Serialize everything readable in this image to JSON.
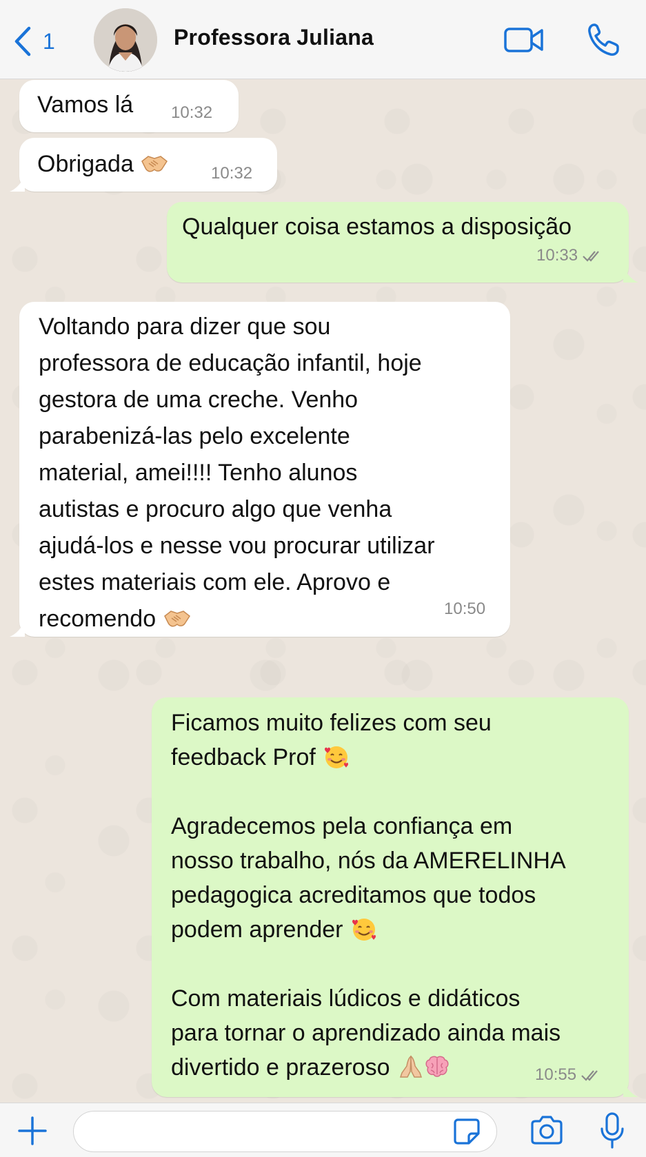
{
  "header": {
    "back_count": "1",
    "contact_name": "Professora Juliana"
  },
  "messages": [
    {
      "direction": "in",
      "text": "Vamos lá",
      "time": "10:32"
    },
    {
      "direction": "in",
      "text": "Obrigada",
      "emoji": "handshake",
      "time": "10:32"
    },
    {
      "direction": "out",
      "text": "Qualquer coisa estamos a disposição",
      "time": "10:33",
      "read": true
    },
    {
      "direction": "in",
      "lines": [
        "Voltando para dizer que sou",
        "professora de educação infantil, hoje",
        "gestora de uma creche. Venho",
        "parabenizá-las pelo excelente",
        "material, amei!!!! Tenho alunos",
        "autistas e procuro algo que venha",
        "ajudá-los e nesse vou procurar utilizar",
        "estes materiais com ele. Aprovo e",
        "recomendo"
      ],
      "emoji": "handshake",
      "time": "10:50"
    },
    {
      "direction": "out",
      "lines": [
        "Ficamos muito felizes com seu",
        "feedback Prof",
        "",
        "Agradecemos pela confiança em",
        "nosso trabalho, nós da AMERELINHA",
        "pedagogica acreditamos que todos",
        "podem aprender",
        "",
        "Com materiais lúdicos e didáticos",
        "para tornar o aprendizado ainda mais",
        "divertido e prazeroso"
      ],
      "emojis": [
        "smiling-face-with-hearts",
        "smiling-face-with-hearts",
        "folded-hands",
        "brain"
      ],
      "time": "10:55",
      "read": true
    }
  ],
  "input": {
    "placeholder": ""
  },
  "colors": {
    "accent": "#1a73d8",
    "incoming_bubble": "#ffffff",
    "outgoing_bubble": "#dcf8c6",
    "chat_background": "#ece5dd"
  }
}
